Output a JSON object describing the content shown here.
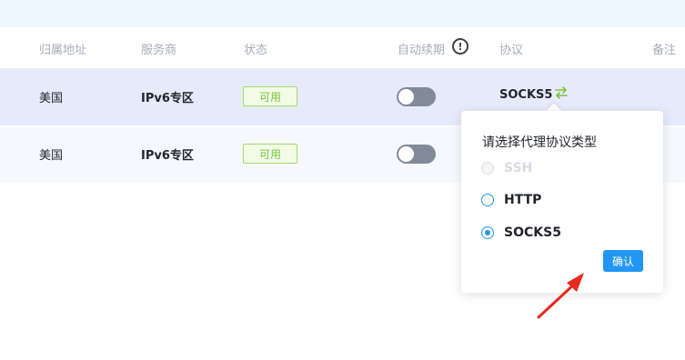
{
  "table": {
    "headers": {
      "location": "归属地址",
      "provider": "服务商",
      "status": "状态",
      "auto_renew": "自动续期",
      "protocol": "协议",
      "note": "备注"
    },
    "rows": [
      {
        "location": "美国",
        "provider": "IPv6专区",
        "status": "可用",
        "protocol": "SOCKS5",
        "auto_renew": false
      },
      {
        "location": "美国",
        "provider": "IPv6专区",
        "status": "可用",
        "auto_renew": false
      }
    ]
  },
  "icons": {
    "info": "info-circle-icon",
    "swap": "swap-arrows-icon"
  },
  "popover": {
    "title": "请选择代理协议类型",
    "options": [
      {
        "label": "SSH",
        "disabled": true,
        "checked": false
      },
      {
        "label": "HTTP",
        "disabled": false,
        "checked": false
      },
      {
        "label": "SOCKS5",
        "disabled": false,
        "checked": true
      }
    ],
    "confirm_label": "确认"
  },
  "colors": {
    "accent": "#2196f3",
    "status_green": "#7cc23b",
    "row_highlight": "#e6ebfb",
    "toggle_off": "#808a98",
    "annotation_red": "#e8291c"
  }
}
